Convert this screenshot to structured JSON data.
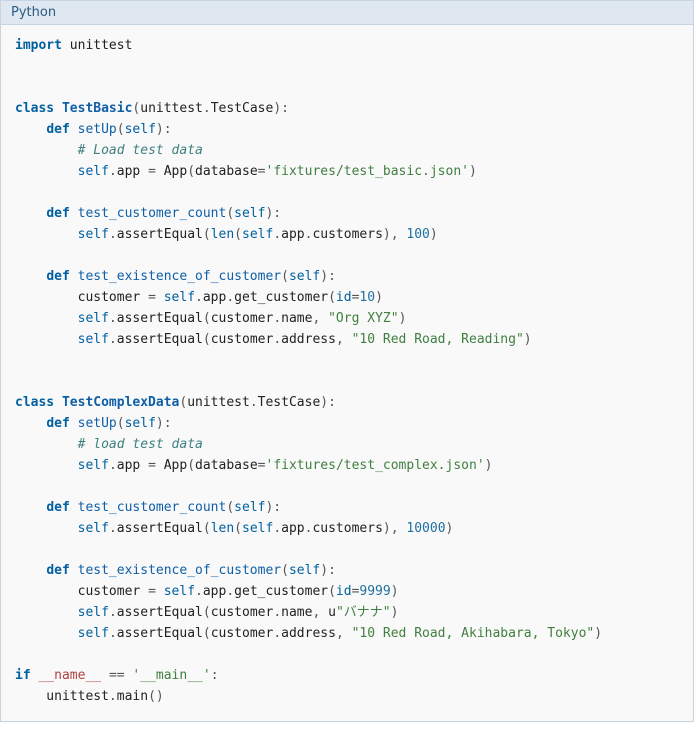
{
  "header": {
    "title": "Python"
  },
  "code": {
    "tokens": [
      {
        "cls": "kw",
        "t": "import"
      },
      {
        "cls": "id",
        "t": " "
      },
      {
        "cls": "id",
        "t": "unittest"
      },
      {
        "cls": "id",
        "t": "\n"
      },
      {
        "cls": "id",
        "t": "\n"
      },
      {
        "cls": "id",
        "t": "\n"
      },
      {
        "cls": "kw",
        "t": "class"
      },
      {
        "cls": "id",
        "t": " "
      },
      {
        "cls": "cls",
        "t": "TestBasic"
      },
      {
        "cls": "op",
        "t": "("
      },
      {
        "cls": "id",
        "t": "unittest"
      },
      {
        "cls": "op",
        "t": "."
      },
      {
        "cls": "id",
        "t": "TestCase"
      },
      {
        "cls": "op",
        "t": "):"
      },
      {
        "cls": "id",
        "t": "\n"
      },
      {
        "cls": "id",
        "t": "    "
      },
      {
        "cls": "kw",
        "t": "def"
      },
      {
        "cls": "id",
        "t": " "
      },
      {
        "cls": "fn",
        "t": "setUp"
      },
      {
        "cls": "op",
        "t": "("
      },
      {
        "cls": "self",
        "t": "self"
      },
      {
        "cls": "op",
        "t": "):"
      },
      {
        "cls": "id",
        "t": "\n"
      },
      {
        "cls": "id",
        "t": "        "
      },
      {
        "cls": "cmt",
        "t": "# Load test data"
      },
      {
        "cls": "id",
        "t": "\n"
      },
      {
        "cls": "id",
        "t": "        "
      },
      {
        "cls": "self",
        "t": "self"
      },
      {
        "cls": "op",
        "t": "."
      },
      {
        "cls": "id",
        "t": "app "
      },
      {
        "cls": "op",
        "t": "="
      },
      {
        "cls": "id",
        "t": " App"
      },
      {
        "cls": "op",
        "t": "("
      },
      {
        "cls": "id",
        "t": "database"
      },
      {
        "cls": "op",
        "t": "="
      },
      {
        "cls": "str",
        "t": "'fixtures/test_basic.json'"
      },
      {
        "cls": "op",
        "t": ")"
      },
      {
        "cls": "id",
        "t": "\n"
      },
      {
        "cls": "id",
        "t": "\n"
      },
      {
        "cls": "id",
        "t": "    "
      },
      {
        "cls": "kw",
        "t": "def"
      },
      {
        "cls": "id",
        "t": " "
      },
      {
        "cls": "fn",
        "t": "test_customer_count"
      },
      {
        "cls": "op",
        "t": "("
      },
      {
        "cls": "self",
        "t": "self"
      },
      {
        "cls": "op",
        "t": "):"
      },
      {
        "cls": "id",
        "t": "\n"
      },
      {
        "cls": "id",
        "t": "        "
      },
      {
        "cls": "self",
        "t": "self"
      },
      {
        "cls": "op",
        "t": "."
      },
      {
        "cls": "id",
        "t": "assertEqual"
      },
      {
        "cls": "op",
        "t": "("
      },
      {
        "cls": "nb",
        "t": "len"
      },
      {
        "cls": "op",
        "t": "("
      },
      {
        "cls": "self",
        "t": "self"
      },
      {
        "cls": "op",
        "t": "."
      },
      {
        "cls": "id",
        "t": "app"
      },
      {
        "cls": "op",
        "t": "."
      },
      {
        "cls": "id",
        "t": "customers"
      },
      {
        "cls": "op",
        "t": "), "
      },
      {
        "cls": "num",
        "t": "100"
      },
      {
        "cls": "op",
        "t": ")"
      },
      {
        "cls": "id",
        "t": "\n"
      },
      {
        "cls": "id",
        "t": "\n"
      },
      {
        "cls": "id",
        "t": "    "
      },
      {
        "cls": "kw",
        "t": "def"
      },
      {
        "cls": "id",
        "t": " "
      },
      {
        "cls": "fn",
        "t": "test_existence_of_customer"
      },
      {
        "cls": "op",
        "t": "("
      },
      {
        "cls": "self",
        "t": "self"
      },
      {
        "cls": "op",
        "t": "):"
      },
      {
        "cls": "id",
        "t": "\n"
      },
      {
        "cls": "id",
        "t": "        customer "
      },
      {
        "cls": "op",
        "t": "="
      },
      {
        "cls": "id",
        "t": " "
      },
      {
        "cls": "self",
        "t": "self"
      },
      {
        "cls": "op",
        "t": "."
      },
      {
        "cls": "id",
        "t": "app"
      },
      {
        "cls": "op",
        "t": "."
      },
      {
        "cls": "id",
        "t": "get_customer"
      },
      {
        "cls": "op",
        "t": "("
      },
      {
        "cls": "nb",
        "t": "id"
      },
      {
        "cls": "op",
        "t": "="
      },
      {
        "cls": "num",
        "t": "10"
      },
      {
        "cls": "op",
        "t": ")"
      },
      {
        "cls": "id",
        "t": "\n"
      },
      {
        "cls": "id",
        "t": "        "
      },
      {
        "cls": "self",
        "t": "self"
      },
      {
        "cls": "op",
        "t": "."
      },
      {
        "cls": "id",
        "t": "assertEqual"
      },
      {
        "cls": "op",
        "t": "("
      },
      {
        "cls": "id",
        "t": "customer"
      },
      {
        "cls": "op",
        "t": "."
      },
      {
        "cls": "id",
        "t": "name"
      },
      {
        "cls": "op",
        "t": ", "
      },
      {
        "cls": "str",
        "t": "\"Org XYZ\""
      },
      {
        "cls": "op",
        "t": ")"
      },
      {
        "cls": "id",
        "t": "\n"
      },
      {
        "cls": "id",
        "t": "        "
      },
      {
        "cls": "self",
        "t": "self"
      },
      {
        "cls": "op",
        "t": "."
      },
      {
        "cls": "id",
        "t": "assertEqual"
      },
      {
        "cls": "op",
        "t": "("
      },
      {
        "cls": "id",
        "t": "customer"
      },
      {
        "cls": "op",
        "t": "."
      },
      {
        "cls": "id",
        "t": "address"
      },
      {
        "cls": "op",
        "t": ", "
      },
      {
        "cls": "str",
        "t": "\"10 Red Road, Reading\""
      },
      {
        "cls": "op",
        "t": ")"
      },
      {
        "cls": "id",
        "t": "\n"
      },
      {
        "cls": "id",
        "t": "\n"
      },
      {
        "cls": "id",
        "t": "\n"
      },
      {
        "cls": "kw",
        "t": "class"
      },
      {
        "cls": "id",
        "t": " "
      },
      {
        "cls": "cls",
        "t": "TestComplexData"
      },
      {
        "cls": "op",
        "t": "("
      },
      {
        "cls": "id",
        "t": "unittest"
      },
      {
        "cls": "op",
        "t": "."
      },
      {
        "cls": "id",
        "t": "TestCase"
      },
      {
        "cls": "op",
        "t": "):"
      },
      {
        "cls": "id",
        "t": "\n"
      },
      {
        "cls": "id",
        "t": "    "
      },
      {
        "cls": "kw",
        "t": "def"
      },
      {
        "cls": "id",
        "t": " "
      },
      {
        "cls": "fn",
        "t": "setUp"
      },
      {
        "cls": "op",
        "t": "("
      },
      {
        "cls": "self",
        "t": "self"
      },
      {
        "cls": "op",
        "t": "):"
      },
      {
        "cls": "id",
        "t": "\n"
      },
      {
        "cls": "id",
        "t": "        "
      },
      {
        "cls": "cmt",
        "t": "# load test data"
      },
      {
        "cls": "id",
        "t": "\n"
      },
      {
        "cls": "id",
        "t": "        "
      },
      {
        "cls": "self",
        "t": "self"
      },
      {
        "cls": "op",
        "t": "."
      },
      {
        "cls": "id",
        "t": "app "
      },
      {
        "cls": "op",
        "t": "="
      },
      {
        "cls": "id",
        "t": " App"
      },
      {
        "cls": "op",
        "t": "("
      },
      {
        "cls": "id",
        "t": "database"
      },
      {
        "cls": "op",
        "t": "="
      },
      {
        "cls": "str",
        "t": "'fixtures/test_complex.json'"
      },
      {
        "cls": "op",
        "t": ")"
      },
      {
        "cls": "id",
        "t": "\n"
      },
      {
        "cls": "id",
        "t": "\n"
      },
      {
        "cls": "id",
        "t": "    "
      },
      {
        "cls": "kw",
        "t": "def"
      },
      {
        "cls": "id",
        "t": " "
      },
      {
        "cls": "fn",
        "t": "test_customer_count"
      },
      {
        "cls": "op",
        "t": "("
      },
      {
        "cls": "self",
        "t": "self"
      },
      {
        "cls": "op",
        "t": "):"
      },
      {
        "cls": "id",
        "t": "\n"
      },
      {
        "cls": "id",
        "t": "        "
      },
      {
        "cls": "self",
        "t": "self"
      },
      {
        "cls": "op",
        "t": "."
      },
      {
        "cls": "id",
        "t": "assertEqual"
      },
      {
        "cls": "op",
        "t": "("
      },
      {
        "cls": "nb",
        "t": "len"
      },
      {
        "cls": "op",
        "t": "("
      },
      {
        "cls": "self",
        "t": "self"
      },
      {
        "cls": "op",
        "t": "."
      },
      {
        "cls": "id",
        "t": "app"
      },
      {
        "cls": "op",
        "t": "."
      },
      {
        "cls": "id",
        "t": "customers"
      },
      {
        "cls": "op",
        "t": "), "
      },
      {
        "cls": "num",
        "t": "10000"
      },
      {
        "cls": "op",
        "t": ")"
      },
      {
        "cls": "id",
        "t": "\n"
      },
      {
        "cls": "id",
        "t": "\n"
      },
      {
        "cls": "id",
        "t": "    "
      },
      {
        "cls": "kw",
        "t": "def"
      },
      {
        "cls": "id",
        "t": " "
      },
      {
        "cls": "fn",
        "t": "test_existence_of_customer"
      },
      {
        "cls": "op",
        "t": "("
      },
      {
        "cls": "self",
        "t": "self"
      },
      {
        "cls": "op",
        "t": "):"
      },
      {
        "cls": "id",
        "t": "\n"
      },
      {
        "cls": "id",
        "t": "        customer "
      },
      {
        "cls": "op",
        "t": "="
      },
      {
        "cls": "id",
        "t": " "
      },
      {
        "cls": "self",
        "t": "self"
      },
      {
        "cls": "op",
        "t": "."
      },
      {
        "cls": "id",
        "t": "app"
      },
      {
        "cls": "op",
        "t": "."
      },
      {
        "cls": "id",
        "t": "get_customer"
      },
      {
        "cls": "op",
        "t": "("
      },
      {
        "cls": "nb",
        "t": "id"
      },
      {
        "cls": "op",
        "t": "="
      },
      {
        "cls": "num",
        "t": "9999"
      },
      {
        "cls": "op",
        "t": ")"
      },
      {
        "cls": "id",
        "t": "\n"
      },
      {
        "cls": "id",
        "t": "        "
      },
      {
        "cls": "self",
        "t": "self"
      },
      {
        "cls": "op",
        "t": "."
      },
      {
        "cls": "id",
        "t": "assertEqual"
      },
      {
        "cls": "op",
        "t": "("
      },
      {
        "cls": "id",
        "t": "customer"
      },
      {
        "cls": "op",
        "t": "."
      },
      {
        "cls": "id",
        "t": "name"
      },
      {
        "cls": "op",
        "t": ", "
      },
      {
        "cls": "id",
        "t": "u"
      },
      {
        "cls": "str",
        "t": "\"バナナ\""
      },
      {
        "cls": "op",
        "t": ")"
      },
      {
        "cls": "id",
        "t": "\n"
      },
      {
        "cls": "id",
        "t": "        "
      },
      {
        "cls": "self",
        "t": "self"
      },
      {
        "cls": "op",
        "t": "."
      },
      {
        "cls": "id",
        "t": "assertEqual"
      },
      {
        "cls": "op",
        "t": "("
      },
      {
        "cls": "id",
        "t": "customer"
      },
      {
        "cls": "op",
        "t": "."
      },
      {
        "cls": "id",
        "t": "address"
      },
      {
        "cls": "op",
        "t": ", "
      },
      {
        "cls": "str",
        "t": "\"10 Red Road, Akihabara, Tokyo\""
      },
      {
        "cls": "op",
        "t": ")"
      },
      {
        "cls": "id",
        "t": "\n"
      },
      {
        "cls": "id",
        "t": "\n"
      },
      {
        "cls": "kw",
        "t": "if"
      },
      {
        "cls": "id",
        "t": " "
      },
      {
        "cls": "mag",
        "t": "__name__"
      },
      {
        "cls": "id",
        "t": " "
      },
      {
        "cls": "op",
        "t": "=="
      },
      {
        "cls": "id",
        "t": " "
      },
      {
        "cls": "str",
        "t": "'__main__'"
      },
      {
        "cls": "op",
        "t": ":"
      },
      {
        "cls": "id",
        "t": "\n"
      },
      {
        "cls": "id",
        "t": "    unittest"
      },
      {
        "cls": "op",
        "t": "."
      },
      {
        "cls": "id",
        "t": "main"
      },
      {
        "cls": "op",
        "t": "()"
      },
      {
        "cls": "id",
        "t": "\n"
      }
    ]
  }
}
